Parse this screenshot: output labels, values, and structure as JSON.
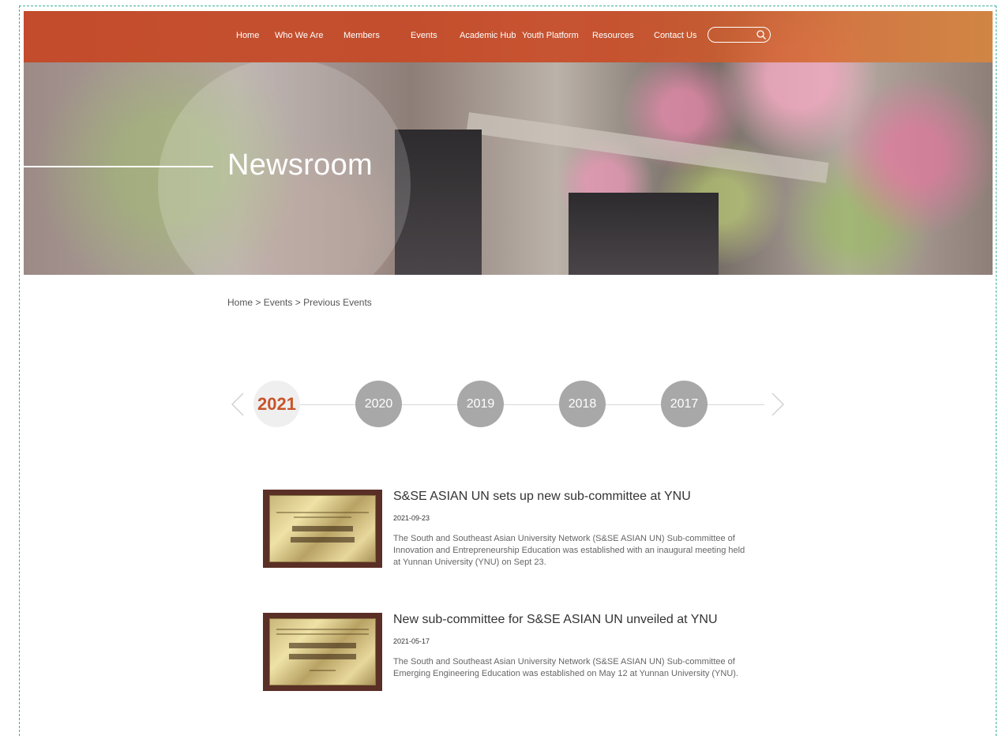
{
  "nav": {
    "items": [
      "Home",
      "Who We Are",
      "Members",
      "Events",
      "Academic Hub",
      "Youth Platform",
      "Resources",
      "Contact Us"
    ],
    "search_placeholder": ""
  },
  "hero": {
    "title": "Newsroom"
  },
  "breadcrumb": {
    "home": "Home",
    "sep": " > ",
    "events": "Events",
    "current": "Previous Events"
  },
  "timeline": {
    "years": [
      "2021",
      "2020",
      "2019",
      "2018",
      "2017"
    ],
    "active": "2021"
  },
  "news": [
    {
      "title": "S&SE ASIAN UN sets up new sub-committee at YNU",
      "date": "2021-09-23",
      "desc": "The South and Southeast Asian University Network (S&SE ASIAN UN) Sub-committee of Innovation and Entrepreneurship Education was established with an inaugural meeting held at Yunnan University (YNU) on Sept 23."
    },
    {
      "title": "New sub-committee for S&SE ASIAN UN unveiled at YNU",
      "date": "2021-05-17",
      "desc": "The South and Southeast Asian University Network (S&SE ASIAN UN) Sub-committee of Emerging Engineering Education was established on May 12 at Yunnan University (YNU)."
    }
  ],
  "colors": {
    "nav_bg": "#c4482a",
    "accent": "#c8542a",
    "year_inactive": "#a8a8a8",
    "frame_dash": "#3ab09b"
  }
}
